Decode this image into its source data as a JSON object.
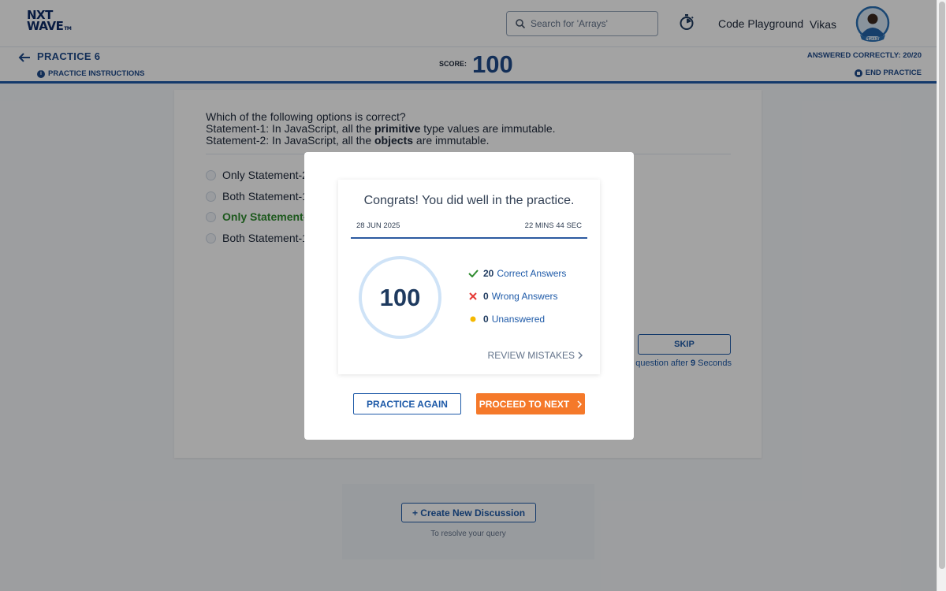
{
  "header": {
    "logo_line1": "NXT",
    "logo_line2": "WAVE",
    "logo_tm": "TM",
    "search_placeholder": "Search for 'Arrays'",
    "playground_label": "Code Playground",
    "username": "Vikas",
    "avatar_badge": "SMART"
  },
  "practice": {
    "title": "PRACTICE 6",
    "instructions_label": "PRACTICE INSTRUCTIONS",
    "score_label": "SCORE:",
    "score_value": "100",
    "answered_label": "ANSWERED CORRECTLY: 20/20",
    "end_label": "END PRACTICE"
  },
  "question": {
    "line1": "Which of the following options is correct?",
    "line2_pre": "Statement-1: In JavaScript, all the ",
    "line2_bold": "primitive",
    "line2_post": " type values are immutable.",
    "line3_pre": "Statement-2: In JavaScript, all the ",
    "line3_bold": "objects",
    "line3_post": " are immutable.",
    "options": [
      {
        "label": "Only Statement-2"
      },
      {
        "label": "Both Statement-1"
      },
      {
        "label": "Only Statement-1"
      },
      {
        "label": "Both Statement-1"
      }
    ],
    "skip_label": "SKIP",
    "next_note_pre": "question after ",
    "next_note_seconds": "9",
    "next_note_post": " Seconds"
  },
  "discussion": {
    "create_label": "+ Create New Discussion",
    "resolve_text": "To resolve your query"
  },
  "modal": {
    "congrats": "Congrats! You did well in the practice.",
    "date": "28 JUN 2025",
    "duration": "22 MINS 44 SEC",
    "score": "100",
    "correct_count": "20",
    "correct_label": "Correct Answers",
    "wrong_count": "0",
    "wrong_label": "Wrong Answers",
    "unanswered_count": "0",
    "unanswered_label": "Unanswered",
    "review_label": "REVIEW MISTAKES",
    "practice_again_label": "PRACTICE AGAIN",
    "proceed_label": "PROCEED TO NEXT"
  },
  "colors": {
    "brand_blue": "#1e4a8a",
    "accent_orange": "#f5792a",
    "correct_green": "#2e8b2e",
    "wrong_red": "#e53935",
    "unanswered_yellow": "#f5b800"
  }
}
